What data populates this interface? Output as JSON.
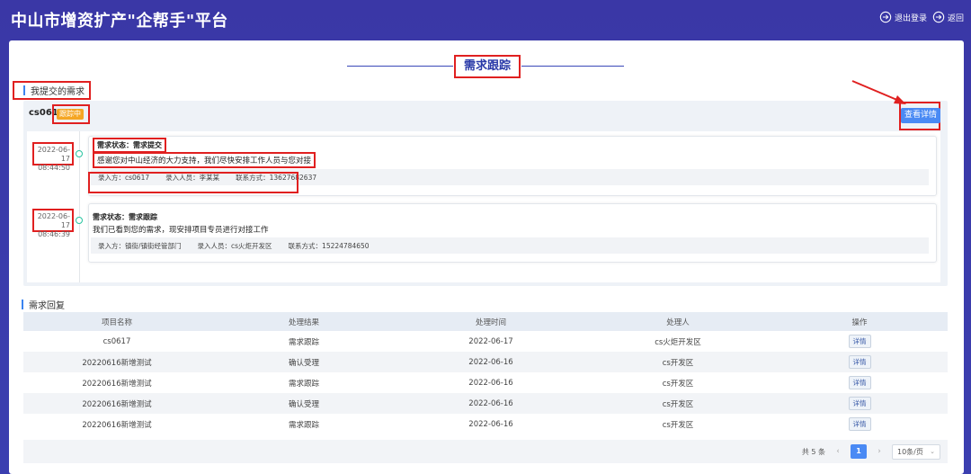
{
  "header": {
    "title": "中山市增资扩产\"企帮手\"平台",
    "logout_label": "退出登录",
    "back_label": "返回"
  },
  "page_title": "需求跟踪",
  "section_submitted": "我提交的需求",
  "request": {
    "id": "cs0617",
    "tag": "跟踪中",
    "detail_button": "查看详情"
  },
  "timeline": [
    {
      "date": "2022-06-17",
      "time": "08:44:50",
      "status": "需求状态：需求提交",
      "message": "感谢您对中山经济的大力支持，我们尽快安排工作人员与您对接",
      "entry_party": "录入方：cs0617",
      "entry_person": "录入人员：李某某",
      "contact": "联系方式：13627682637"
    },
    {
      "date": "2022-06-17",
      "time": "08:46:39",
      "status": "需求状态：需求跟踪",
      "message": "我们已看到您的需求，现安排项目专员进行对接工作",
      "entry_party": "录入方：镇街/镇街经管部门",
      "entry_person": "录入人员：cs火炬开发区",
      "contact": "联系方式：15224784650"
    }
  ],
  "section_reply": "需求回复",
  "table": {
    "headers": [
      "项目名称",
      "处理结果",
      "处理时间",
      "处理人",
      "操作"
    ],
    "rows": [
      [
        "cs0617",
        "需求跟踪",
        "2022-06-17",
        "cs火炬开发区",
        "详情"
      ],
      [
        "20220616新增测试",
        "确认受理",
        "2022-06-16",
        "cs开发区",
        "详情"
      ],
      [
        "20220616新增测试",
        "需求跟踪",
        "2022-06-16",
        "cs开发区",
        "详情"
      ],
      [
        "20220616新增测试",
        "确认受理",
        "2022-06-16",
        "cs开发区",
        "详情"
      ],
      [
        "20220616新增测试",
        "需求跟踪",
        "2022-06-16",
        "cs开发区",
        "详情"
      ]
    ]
  },
  "pagination": {
    "total": "共 5 条",
    "current_page": "1",
    "page_size": "10条/页"
  },
  "colors": {
    "header_bg": "#3a37a6",
    "accent": "#4a8af4",
    "tag": "#f5a623",
    "annotation": "#e02020"
  }
}
